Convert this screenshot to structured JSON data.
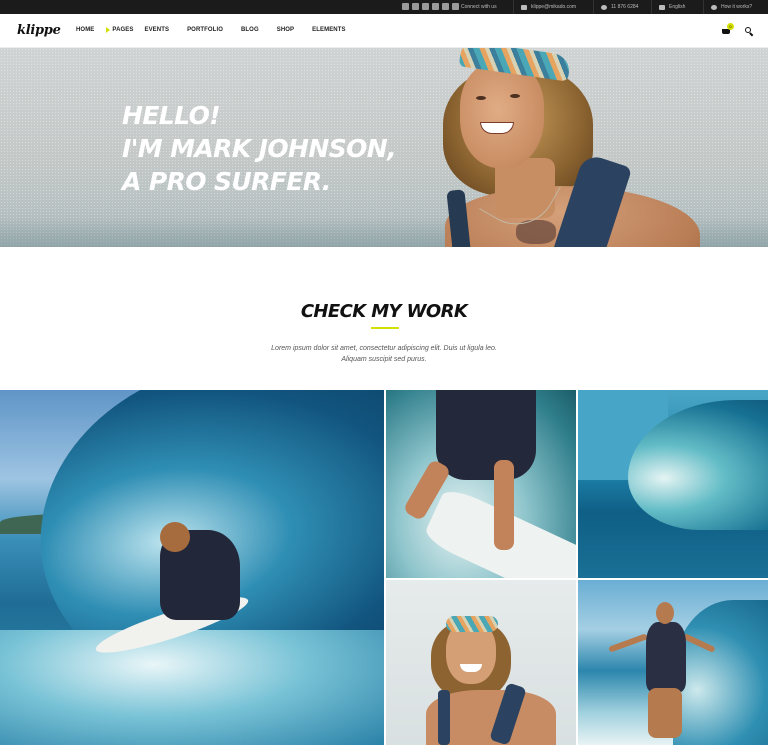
{
  "topbar": {
    "connect_label": "Connect with us",
    "email": "klippe@mikado.com",
    "phone": "11 876 6284",
    "language": "English",
    "help": "How it works?",
    "social_icons": [
      "vimeo-icon",
      "linkedin-icon",
      "facebook-icon",
      "twitter-icon",
      "youtube-icon",
      "instagram-icon"
    ]
  },
  "header": {
    "logo": "klippe",
    "nav": [
      "HOME",
      "PAGES",
      "EVENTS",
      "PORTFOLIO",
      "BLOG",
      "SHOP",
      "ELEMENTS"
    ],
    "cart_count": "0"
  },
  "hero": {
    "line1": "HELLO!",
    "line2": "I'M MARK JOHNSON,",
    "line3": "A PRO SURFER."
  },
  "work": {
    "title": "CHECK MY WORK",
    "text1": "Lorem ipsum dolor sit amet, consectetur adipiscing elit. Duis ut ligula leo.",
    "text2": "Aliquam suscipit sed purus."
  },
  "colors": {
    "accent": "#d4e000",
    "topbar": "#1b1b1b"
  }
}
